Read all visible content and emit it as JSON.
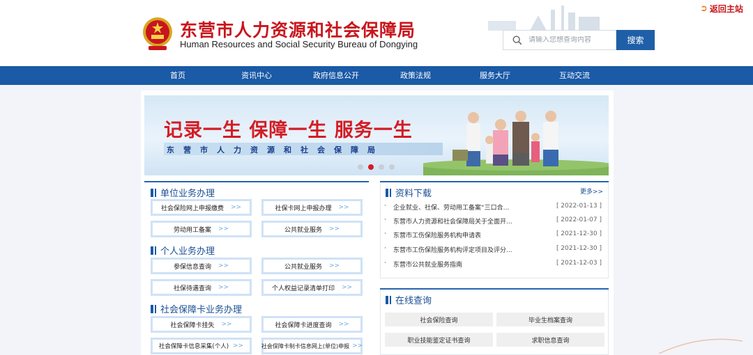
{
  "header": {
    "title": "东营市人力资源和社会保障局",
    "subtitle": "Human Resources and Social Security Bureau of Dongying",
    "return_link": "返回主站",
    "search": {
      "placeholder": "请输入您想查询内容",
      "button_label": "搜索"
    }
  },
  "nav": {
    "items": [
      "首页",
      "资讯中心",
      "政府信息公开",
      "政策法规",
      "服务大厅",
      "互动交流"
    ]
  },
  "banner": {
    "slogan": "记录一生 保障一生 服务一生",
    "subtitle": "东营市人力资源和社会保障局",
    "slide_count": 4,
    "active_slide": 2
  },
  "unit_services": {
    "heading": "单位业务办理",
    "items": [
      "社会保险网上申报缴费",
      "社保卡网上申报办理",
      "劳动用工备案",
      "公共就业服务"
    ]
  },
  "personal_services": {
    "heading": "个人业务办理",
    "items": [
      "参保信息查询",
      "公共就业服务",
      "社保待遇查询",
      "个人权益记录清单打印"
    ]
  },
  "card_services": {
    "heading": "社会保障卡业务办理",
    "items": [
      "社会保障卡挂失",
      "社会保障卡进度查询",
      "社会保障卡信息采集(个人)",
      "社会保障卡制卡信息网上(单位)申报"
    ]
  },
  "chevron": ">>",
  "downloads": {
    "heading": "资料下载",
    "more": "更多>>",
    "bullet": "·",
    "items": [
      {
        "title": "企业就业、社保、劳动用工备案“三口合...",
        "date": "[ 2022-01-13 ]"
      },
      {
        "title": "东营市人力资源和社会保障局关于全面开...",
        "date": "[ 2022-01-07 ]"
      },
      {
        "title": "东营市工伤保险服务机构申请表",
        "date": "[ 2021-12-30 ]"
      },
      {
        "title": "东营市工伤保险服务机构评定项目及评分...",
        "date": "[ 2021-12-30 ]"
      },
      {
        "title": "东营市公共就业服务指南",
        "date": "[ 2021-12-03 ]"
      }
    ]
  },
  "online_query": {
    "heading": "在线查询",
    "items": [
      "社会保险查询",
      "毕业生档案查询",
      "职业技能鉴定证书查询",
      "求职信息查询"
    ]
  },
  "colors": {
    "brand_red": "#c8161d",
    "nav_blue": "#1a5aa6",
    "heading_blue": "#1a4f94",
    "button_border": "#cfe2f6"
  }
}
